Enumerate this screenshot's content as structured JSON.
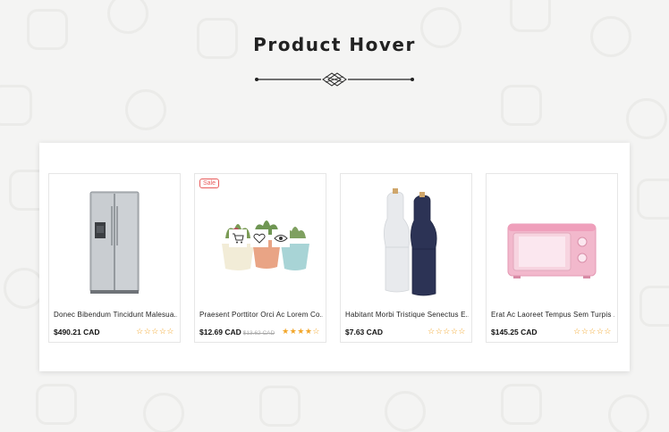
{
  "section": {
    "title": "Product Hover"
  },
  "products": [
    {
      "name": "Donec Bibendum Tincidunt Malesua...",
      "price": "$490.21 CAD",
      "old_price": "",
      "sale_label": "",
      "rating": 0,
      "image_icon": "refrigerator-image"
    },
    {
      "name": "Praesent Porttitor Orci Ac Lorem Co...",
      "price": "$12.69 CAD",
      "old_price": "$13.62 CAD",
      "sale_label": "Sale",
      "rating": 4,
      "image_icon": "succulent-pots-image"
    },
    {
      "name": "Habitant Morbi Tristique Senectus E...",
      "price": "$7.63 CAD",
      "old_price": "",
      "sale_label": "",
      "rating": 0,
      "image_icon": "salt-pepper-grinders-image"
    },
    {
      "name": "Erat Ac Laoreet Tempus Sem Turpis ...",
      "price": "$145.25 CAD",
      "old_price": "",
      "sale_label": "",
      "rating": 0,
      "image_icon": "microwave-oven-image"
    }
  ],
  "hover_actions": [
    "cart-icon",
    "wishlist-heart-icon",
    "quick-view-eye-icon"
  ],
  "colors": {
    "sale": "#e85c5c",
    "star": "#f2a62a",
    "background": "#f4f4f3"
  }
}
